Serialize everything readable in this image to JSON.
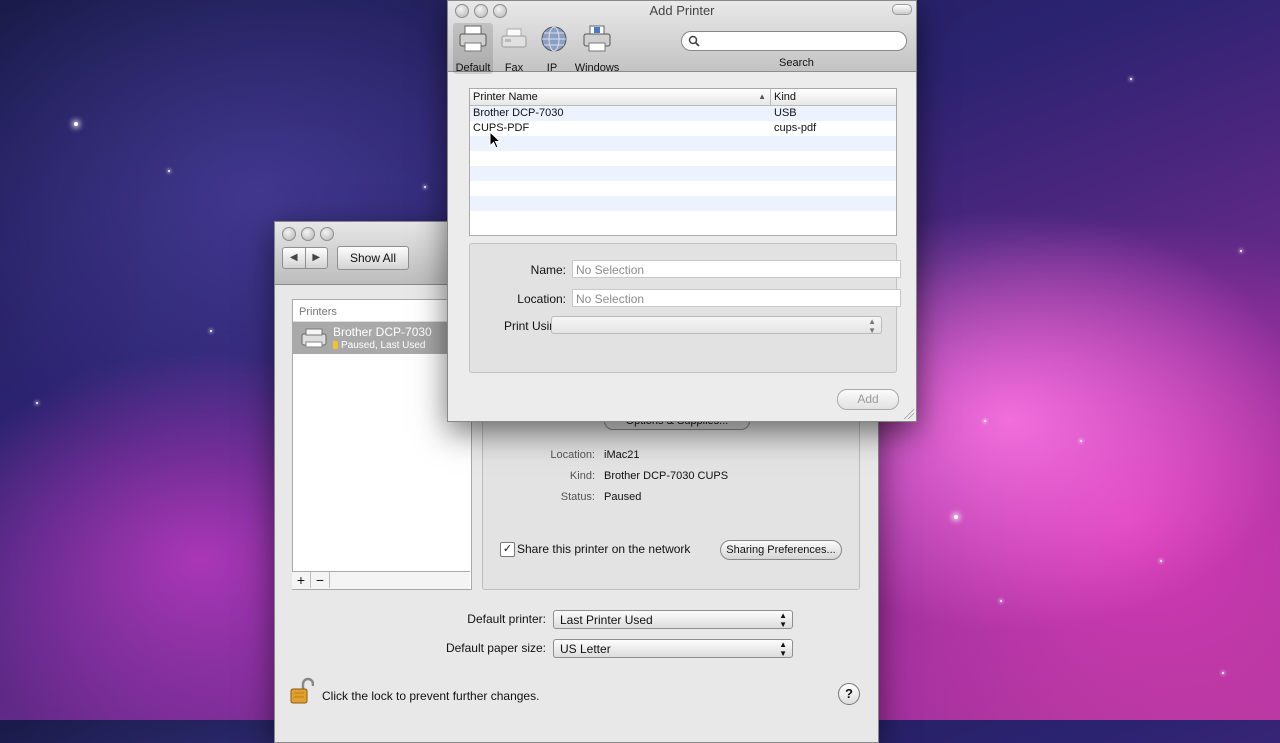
{
  "prefs_window": {
    "nav_back": "◀",
    "nav_forward": "▶",
    "show_all": "Show All",
    "printers_header": "Printers",
    "selected_printer": {
      "name": "Brother DCP-7030",
      "status": "Paused, Last Used"
    },
    "add_button": "+",
    "remove_button": "−",
    "options_button": "Options & Supplies...",
    "details": [
      {
        "key": "Location:",
        "value": "iMac21"
      },
      {
        "key": "Kind:",
        "value": "Brother DCP-7030 CUPS"
      },
      {
        "key": "Status:",
        "value": "Paused"
      }
    ],
    "share_checkbox": {
      "checked": true,
      "label": "Share this printer on the network"
    },
    "sharing_prefs_button": "Sharing Preferences...",
    "default_printer_label": "Default printer:",
    "default_printer_value": "Last Printer Used",
    "default_paper_label": "Default paper size:",
    "default_paper_value": "US Letter",
    "lock_text": "Click the lock to prevent further changes.",
    "help_button": "?"
  },
  "add_printer_window": {
    "title": "Add Printer",
    "toolbar": [
      {
        "label": "Default",
        "icon": "printer-icon",
        "active": true
      },
      {
        "label": "Fax",
        "icon": "fax-icon",
        "active": false
      },
      {
        "label": "IP",
        "icon": "globe-icon",
        "active": false
      },
      {
        "label": "Windows",
        "icon": "windows-printer-icon",
        "active": false
      }
    ],
    "search_label": "Search",
    "search_value": "",
    "columns": [
      "Printer Name",
      "Kind"
    ],
    "sort_indicator": "▲",
    "rows": [
      {
        "name": "Brother DCP-7030",
        "kind": "USB"
      },
      {
        "name": "CUPS-PDF",
        "kind": "cups-pdf"
      }
    ],
    "form": {
      "name_label": "Name:",
      "name_value": "No Selection",
      "location_label": "Location:",
      "location_value": "No Selection",
      "print_using_label": "Print Using:",
      "print_using_value": ""
    },
    "add_button": "Add"
  }
}
